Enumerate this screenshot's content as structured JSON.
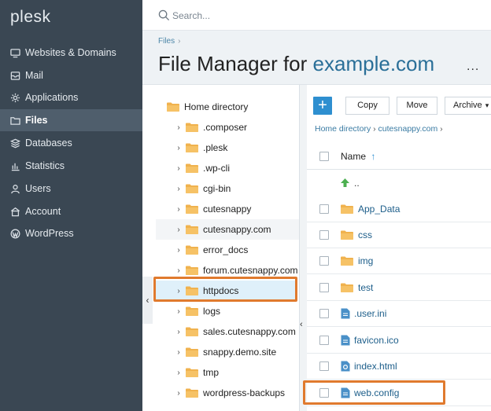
{
  "app": {
    "logo": "plesk"
  },
  "search": {
    "placeholder": "Search..."
  },
  "sidebar": {
    "items": [
      {
        "label": "Websites & Domains",
        "icon": "monitor-icon"
      },
      {
        "label": "Mail",
        "icon": "mail-icon"
      },
      {
        "label": "Applications",
        "icon": "gear-icon"
      },
      {
        "label": "Files",
        "icon": "folder-icon",
        "active": true
      },
      {
        "label": "Databases",
        "icon": "database-icon"
      },
      {
        "label": "Statistics",
        "icon": "bar-chart-icon"
      },
      {
        "label": "Users",
        "icon": "user-icon"
      },
      {
        "label": "Account",
        "icon": "account-icon"
      },
      {
        "label": "WordPress",
        "icon": "wordpress-icon"
      }
    ]
  },
  "header": {
    "breadcrumb": "Files",
    "title_prefix": "File Manager for",
    "title_domain": "example.com",
    "more": "..."
  },
  "tree": {
    "root": "Home directory",
    "items": [
      ".composer",
      ".plesk",
      ".wp-cli",
      "cgi-bin",
      "cutesnappy",
      "cutesnappy.com",
      "error_docs",
      "forum.cutesnappy.com",
      "httpdocs",
      "logs",
      "sales.cutesnappy.com",
      "snappy.demo.site",
      "tmp",
      "wordpress-backups"
    ],
    "selected": "httpdocs"
  },
  "toolbar": {
    "add": "+",
    "copy": "Copy",
    "move": "Move",
    "archive": "Archive"
  },
  "file_breadcrumb": {
    "root": "Home directory",
    "current": "cutesnappy.com"
  },
  "list": {
    "column_name": "Name",
    "sort_indicator": "↑",
    "parent": "..",
    "files": [
      {
        "name": "App_Data",
        "type": "folder"
      },
      {
        "name": "css",
        "type": "folder"
      },
      {
        "name": "img",
        "type": "folder"
      },
      {
        "name": "test",
        "type": "folder"
      },
      {
        "name": ".user.ini",
        "type": "file"
      },
      {
        "name": "favicon.ico",
        "type": "file"
      },
      {
        "name": "index.html",
        "type": "html"
      },
      {
        "name": "web.config",
        "type": "file"
      }
    ]
  },
  "colors": {
    "sidebar": "#3a4753",
    "accent": "#2e8fd0",
    "highlight": "#e07a2e",
    "folder": "#f0b24e"
  }
}
